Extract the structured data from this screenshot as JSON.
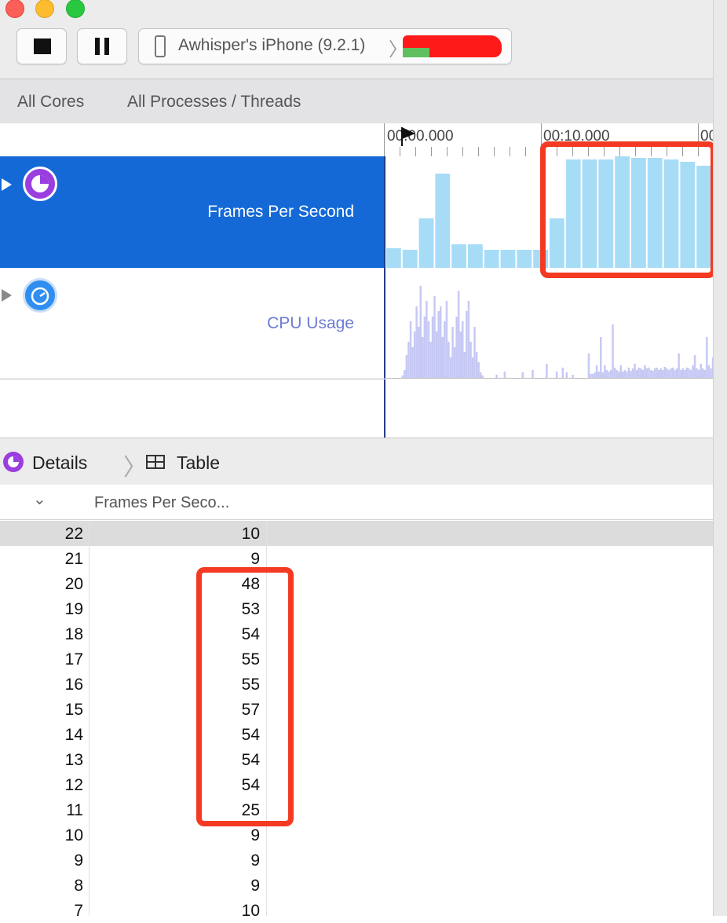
{
  "colors": {
    "selected_track": "#1469d6",
    "fps_bar": "#a7dcf7",
    "cpu_bar": "#c7c9f4",
    "annotation": "#f43a22",
    "fps_icon": "#9a3ee0",
    "cpu_icon": "#2f8ef0"
  },
  "toolbar": {
    "device_label": "Awhisper's iPhone (9.2.1)",
    "separator": "〉"
  },
  "scope": {
    "cores": "All Cores",
    "processes": "All Processes / Threads"
  },
  "ruler": {
    "labels": [
      "00:00.000",
      "00:10.000",
      "00"
    ]
  },
  "tracks": [
    {
      "name": "Frames Per Second",
      "icon": "fps-instrument-icon"
    },
    {
      "name": "CPU Usage",
      "icon": "cpu-gauge-icon"
    }
  ],
  "fps_graph": {
    "values": [
      10,
      9,
      25,
      48,
      12,
      12,
      9,
      9,
      9,
      9,
      25,
      55,
      55,
      55,
      57,
      56,
      56,
      55,
      54,
      52,
      12
    ],
    "max": 60
  },
  "cpu_graph": {
    "values": [
      0,
      2,
      8,
      22,
      35,
      55,
      30,
      45,
      70,
      50,
      90,
      40,
      60,
      75,
      55,
      35,
      60,
      80,
      45,
      65,
      70,
      40,
      55,
      75,
      35,
      20,
      50,
      30,
      60,
      85,
      45,
      55,
      25,
      65,
      75,
      35,
      20,
      50,
      25,
      15,
      5,
      2,
      0,
      0,
      0,
      0,
      0,
      0,
      3,
      0,
      0,
      0,
      6,
      0,
      0,
      0,
      0,
      0,
      0,
      0,
      0,
      5,
      0,
      0,
      0,
      0,
      8,
      0,
      0,
      0,
      0,
      0,
      0,
      14,
      0,
      0,
      0,
      0,
      6,
      0,
      0,
      10,
      0,
      5,
      0,
      0,
      3,
      0,
      0,
      0,
      0,
      0,
      0,
      0,
      24,
      4,
      4,
      5,
      12,
      6,
      40,
      5,
      12,
      8,
      6,
      8,
      52,
      10,
      8,
      6,
      12,
      6,
      8,
      6,
      10,
      7,
      9,
      14,
      8,
      10,
      9,
      8,
      12,
      9,
      10,
      8,
      7,
      9,
      10,
      8,
      9,
      8,
      11,
      9,
      8,
      9,
      10,
      8,
      9,
      24,
      8,
      9,
      8,
      10,
      9,
      8,
      12,
      22,
      9,
      8,
      14,
      9,
      8,
      40,
      12,
      9,
      20,
      10,
      9
    ],
    "max": 100
  },
  "details": {
    "label": "Details",
    "separator": "〉",
    "view": "Table"
  },
  "table": {
    "sort_icon": "chevron-down-icon",
    "column": "Frames Per Seco...",
    "rows": [
      {
        "n": "22",
        "fps": "10"
      },
      {
        "n": "21",
        "fps": "9"
      },
      {
        "n": "20",
        "fps": "48"
      },
      {
        "n": "19",
        "fps": "53"
      },
      {
        "n": "18",
        "fps": "54"
      },
      {
        "n": "17",
        "fps": "55"
      },
      {
        "n": "16",
        "fps": "55"
      },
      {
        "n": "15",
        "fps": "57"
      },
      {
        "n": "14",
        "fps": "54"
      },
      {
        "n": "13",
        "fps": "54"
      },
      {
        "n": "12",
        "fps": "54"
      },
      {
        "n": "11",
        "fps": "25"
      },
      {
        "n": "10",
        "fps": "9"
      },
      {
        "n": "9",
        "fps": "9"
      },
      {
        "n": "8",
        "fps": "9"
      },
      {
        "n": "7",
        "fps": "10"
      }
    ]
  }
}
